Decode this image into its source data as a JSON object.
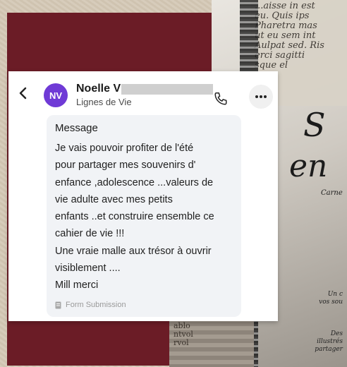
{
  "background": {
    "manuscript_lines": [
      "...aisse in est",
      "eu. Quis ips",
      "Pharetra mas",
      "ut eu sem int",
      "Aulpat sed. Ris",
      "erci sagitti",
      "sque el",
      "s"
    ],
    "cover_line1": "S",
    "cover_line2": "en",
    "cover_line3": "Carne",
    "small_text1": [
      "Un c",
      "vos sou"
    ],
    "small_text2": [
      "Des",
      "illustrés",
      "partager"
    ],
    "book_text": [
      "ablo",
      "ntvol",
      "rvol"
    ]
  },
  "header": {
    "back_icon": "chevron-left-icon",
    "avatar_initials": "NV",
    "avatar_color": "#6f3ad6",
    "contact_name": "Noelle V",
    "contact_subtitle": "Lignes de Vie",
    "call_icon": "phone-icon",
    "more_icon": "more-horizontal-icon"
  },
  "message": {
    "title": "Message",
    "lines": [
      "Je vais pouvoir profiter de l'été",
      "pour partager mes souvenirs d'",
      "enfance ,adolescence ...valeurs de",
      "vie adulte avec mes petits",
      "enfants ..et construire ensemble ce",
      "cahier de vie !!!",
      "Une vraie malle aux trésor à ouvrir",
      "visiblement ....",
      "Mill merci"
    ],
    "source_icon": "form-icon",
    "source_label": "Form Submission"
  },
  "colors": {
    "maroon": "#6b1c26",
    "card": "#ffffff",
    "bubble": "#f1f3f6",
    "accent": "#6f3ad6"
  }
}
